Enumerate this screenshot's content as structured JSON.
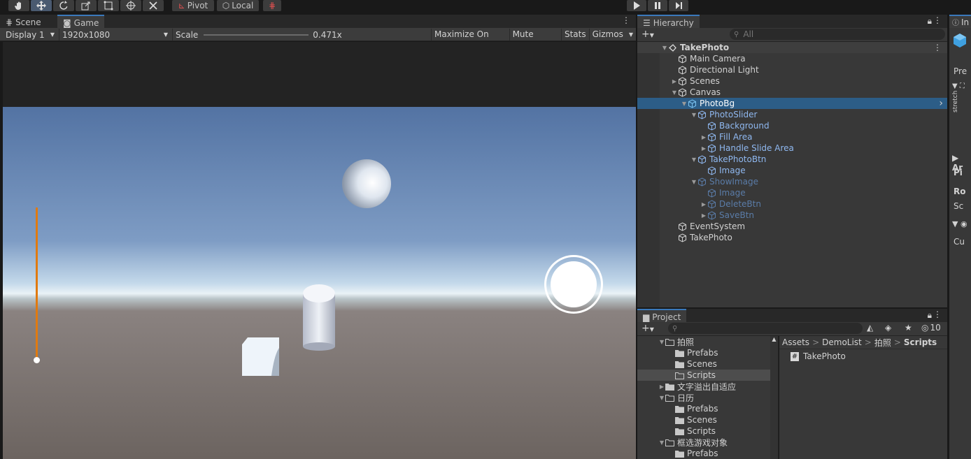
{
  "toolbar": {
    "tools": [
      "hand-tool",
      "move-tool",
      "rotate-tool",
      "scale-tool",
      "rect-tool",
      "transform-tool",
      "custom-tool"
    ],
    "pivot_label": "Pivot",
    "local_label": "Local"
  },
  "game_panel": {
    "tabs": [
      {
        "label": "Scene"
      },
      {
        "label": "Game"
      }
    ],
    "display": "Display 1",
    "resolution": "1920x1080",
    "scale_label": "Scale",
    "scale_value": "0.471x",
    "scale_fraction": 0.0,
    "buttons": [
      "Maximize On Play",
      "Mute Audio",
      "Stats",
      "Gizmos"
    ],
    "slider_fraction": 0.0
  },
  "hierarchy": {
    "tab_label": "Hierarchy",
    "search_placeholder": "All",
    "items": [
      {
        "label": "TakePhoto",
        "depth": 0,
        "arrow": "down",
        "kind": "scene",
        "style": "root"
      },
      {
        "label": "Main Camera",
        "depth": 1,
        "arrow": "",
        "kind": "obj",
        "style": ""
      },
      {
        "label": "Directional Light",
        "depth": 1,
        "arrow": "",
        "kind": "obj",
        "style": ""
      },
      {
        "label": "Scenes",
        "depth": 1,
        "arrow": "right",
        "kind": "obj",
        "style": ""
      },
      {
        "label": "Canvas",
        "depth": 1,
        "arrow": "down",
        "kind": "obj",
        "style": ""
      },
      {
        "label": "PhotoBg",
        "depth": 2,
        "arrow": "down",
        "kind": "prefab",
        "style": "selected"
      },
      {
        "label": "PhotoSlider",
        "depth": 3,
        "arrow": "down",
        "kind": "prefab",
        "style": "blue"
      },
      {
        "label": "Background",
        "depth": 4,
        "arrow": "",
        "kind": "prefab",
        "style": "blue"
      },
      {
        "label": "Fill Area",
        "depth": 4,
        "arrow": "right",
        "kind": "prefab",
        "style": "blue"
      },
      {
        "label": "Handle Slide Area",
        "depth": 4,
        "arrow": "right",
        "kind": "prefab",
        "style": "blue"
      },
      {
        "label": "TakePhotoBtn",
        "depth": 3,
        "arrow": "down",
        "kind": "prefab",
        "style": "blue"
      },
      {
        "label": "Image",
        "depth": 4,
        "arrow": "",
        "kind": "prefab",
        "style": "blue"
      },
      {
        "label": "ShowImage",
        "depth": 3,
        "arrow": "down",
        "kind": "prefab",
        "style": "dim"
      },
      {
        "label": "Image",
        "depth": 4,
        "arrow": "",
        "kind": "prefab",
        "style": "dim"
      },
      {
        "label": "DeleteBtn",
        "depth": 4,
        "arrow": "right",
        "kind": "prefab",
        "style": "dim"
      },
      {
        "label": "SaveBtn",
        "depth": 4,
        "arrow": "right",
        "kind": "prefab",
        "style": "dim"
      },
      {
        "label": "EventSystem",
        "depth": 1,
        "arrow": "",
        "kind": "obj",
        "style": ""
      },
      {
        "label": "TakePhoto",
        "depth": 1,
        "arrow": "",
        "kind": "obj",
        "style": ""
      }
    ]
  },
  "project": {
    "tab_label": "Project",
    "hidden_count": "10",
    "breadcrumb": [
      "Assets",
      "DemoList",
      "拍照",
      "Scripts"
    ],
    "tree": [
      {
        "label": "拍照",
        "depth": 0,
        "arrow": "down",
        "selected": false
      },
      {
        "label": "Prefabs",
        "depth": 1,
        "arrow": "",
        "selected": false
      },
      {
        "label": "Scenes",
        "depth": 1,
        "arrow": "",
        "selected": false
      },
      {
        "label": "Scripts",
        "depth": 1,
        "arrow": "",
        "selected": true
      },
      {
        "label": "文字溢出自适应",
        "depth": 0,
        "arrow": "right",
        "selected": false
      },
      {
        "label": "日历",
        "depth": 0,
        "arrow": "down",
        "selected": false
      },
      {
        "label": "Prefabs",
        "depth": 1,
        "arrow": "",
        "selected": false
      },
      {
        "label": "Scenes",
        "depth": 1,
        "arrow": "",
        "selected": false
      },
      {
        "label": "Scripts",
        "depth": 1,
        "arrow": "",
        "selected": false
      },
      {
        "label": "框选游戏对象",
        "depth": 0,
        "arrow": "down",
        "selected": false
      },
      {
        "label": "Prefabs",
        "depth": 1,
        "arrow": "",
        "selected": false
      }
    ],
    "files": [
      {
        "label": "TakePhoto",
        "icon": "script-icon"
      }
    ]
  },
  "inspector": {
    "labels": [
      "In",
      "Pre",
      "stretch",
      "Ar",
      "Pi",
      "Ro",
      "Sc",
      "Cu"
    ]
  },
  "colors": {
    "accent": "#2c5d87",
    "slider": "#e07a10",
    "selection": "#2c5d87"
  }
}
